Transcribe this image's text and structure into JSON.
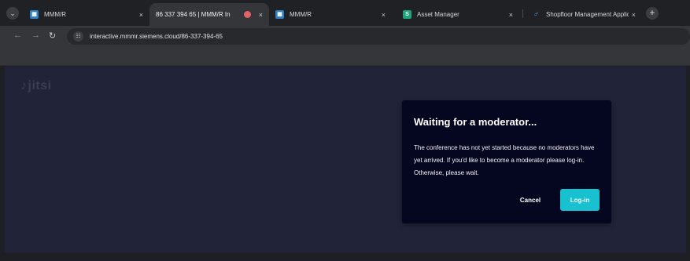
{
  "tabs": [
    {
      "title": "MMM/R",
      "icon": "mmm-icon",
      "active": false
    },
    {
      "title": "86 337 394 65 | MMM/R In",
      "icon": "none",
      "active": true,
      "recording": true
    },
    {
      "title": "MMM/R",
      "icon": "mmm-icon",
      "active": false
    },
    {
      "title": "Asset Manager",
      "icon": "asset-manager-icon",
      "active": false
    },
    {
      "title": "Shopfloor Management Applic",
      "icon": "shopfloor-icon",
      "active": false
    }
  ],
  "tab_close_glyph": "×",
  "new_tab_glyph": "+",
  "menu_glyph": "⌄",
  "address_bar": {
    "url": "interactive.mmmr.siemens.cloud/86-337-394-65"
  },
  "page": {
    "logo_text": "jitsi",
    "background_color": "#212338"
  },
  "dialog": {
    "title": "Waiting for a moderator...",
    "message": "The conference has not yet started because no moderators have yet arrived. If you'd like to become a moderator please log-in. Otherwise, please wait.",
    "cancel_label": "Cancel",
    "login_label": "Log-in",
    "accent_color": "#17c1cf"
  }
}
